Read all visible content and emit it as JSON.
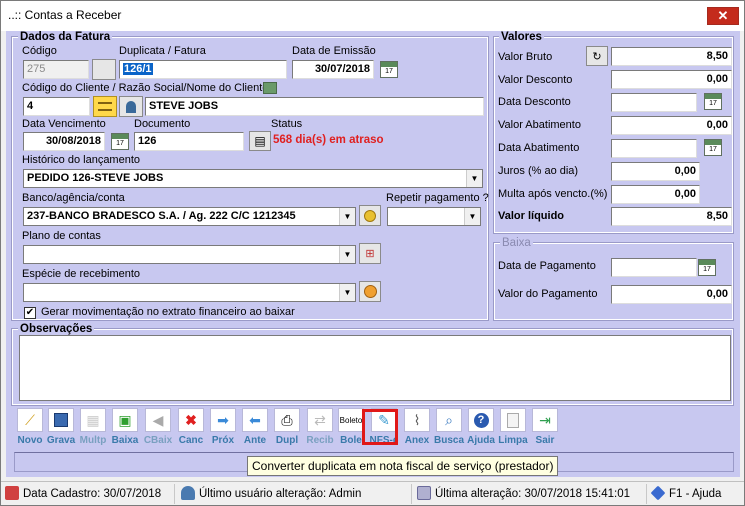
{
  "window": {
    "title": "..:: Contas a Receber",
    "close": "✕"
  },
  "fatura": {
    "section_title": "Dados da Fatura",
    "codigo_label": "Código",
    "codigo_value": "275",
    "duplicata_label": "Duplicata / Fatura",
    "duplicata_value": "126/1",
    "emissao_label": "Data de Emissão",
    "emissao_value": "30/07/2018",
    "cliente_label": "Código do Cliente / Razão Social/Nome do Cliente",
    "cliente_codigo": "4",
    "cliente_nome": "STEVE JOBS",
    "vencimento_label": "Data Vencimento",
    "vencimento_value": "30/08/2018",
    "documento_label": "Documento",
    "documento_value": "126",
    "status_label": "Status",
    "status_value": "568 dia(s) em atraso",
    "historico_label": "Histórico do lançamento",
    "historico_value": "PEDIDO 126-STEVE JOBS",
    "banco_label": "Banco/agência/conta",
    "banco_value": "237-BANCO BRADESCO S.A. / Ag. 222 C/C 1212345",
    "repetir_label": "Repetir pagamento ?",
    "repetir_value": "",
    "plano_label": "Plano de contas",
    "plano_value": "",
    "especie_label": "Espécie de recebimento",
    "especie_value": "",
    "gerar_label": "Gerar movimentação no extrato financeiro ao baixar",
    "gerar_checked": "✔"
  },
  "valores": {
    "section_title": "Valores",
    "bruto_label": "Valor Bruto",
    "bruto_value": "8,50",
    "desconto_label": "Valor Desconto",
    "desconto_value": "0,00",
    "data_desconto_label": "Data Desconto",
    "data_desconto_value": "",
    "abatimento_label": "Valor Abatimento",
    "abatimento_value": "0,00",
    "data_abatimento_label": "Data Abatimento",
    "data_abatimento_value": "",
    "juros_label": "Juros (% ao dia)",
    "juros_value": "0,00",
    "multa_label": "Multa após vencto.(%)",
    "multa_value": "0,00",
    "liquido_label": "Valor líquido",
    "liquido_value": "8,50"
  },
  "baixa": {
    "section_title": "Baixa",
    "data_pagamento_label": "Data de Pagamento",
    "data_pagamento_value": "",
    "valor_pagamento_label": "Valor do Pagamento",
    "valor_pagamento_value": "0,00"
  },
  "observacoes": {
    "section_title": "Observações"
  },
  "toolbar": [
    {
      "label": "Novo",
      "icon": "wand-icon"
    },
    {
      "label": "Grava",
      "icon": "floppy-icon"
    },
    {
      "label": "Multp",
      "icon": "multiply-icon"
    },
    {
      "label": "Baixa",
      "icon": "baixa-icon"
    },
    {
      "label": "CBaix",
      "icon": "cancel-baixa-icon"
    },
    {
      "label": "Canc",
      "icon": "cancel-icon"
    },
    {
      "label": "Próx",
      "icon": "next-icon"
    },
    {
      "label": "Ante",
      "icon": "previous-icon"
    },
    {
      "label": "Dupl",
      "icon": "printer-icon"
    },
    {
      "label": "Recib",
      "icon": "receipt-icon"
    },
    {
      "label": "Bole",
      "icon": "boleto-icon"
    },
    {
      "label": "NFS-e",
      "icon": "nfse-icon"
    },
    {
      "label": "Anex",
      "icon": "paperclip-icon"
    },
    {
      "label": "Busca",
      "icon": "magnifier-icon"
    },
    {
      "label": "Ajuda",
      "icon": "help-icon"
    },
    {
      "label": "Limpa",
      "icon": "clear-icon"
    },
    {
      "label": "Sair",
      "icon": "exit-icon"
    }
  ],
  "boleto_icon_text": "Boleto",
  "tooltip": "Converter duplicata em nota fiscal de serviço (prestador)",
  "statusbar": {
    "cadastro": "Data Cadastro: 30/07/2018",
    "usuario": "Último usuário alteração: Admin",
    "alteracao": "Última alteração: 30/07/2018 15:41:01",
    "ajuda": "F1 - Ajuda"
  },
  "colors": {
    "client_bg": "#c8c8f0",
    "toolbar_label": "#3a7aaa",
    "status_overdue": "#e02020",
    "highlight": "#e01818"
  }
}
